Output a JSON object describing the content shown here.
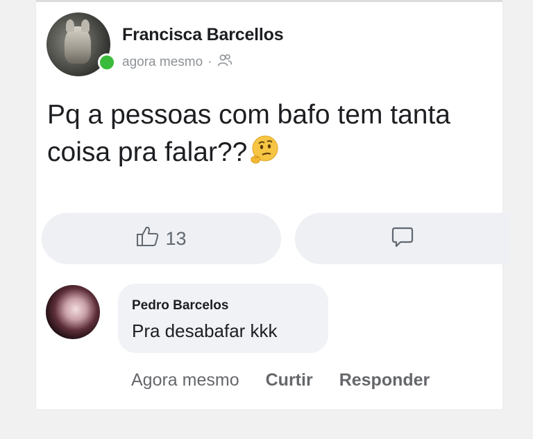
{
  "post": {
    "author": "Francisca Barcellos",
    "timestamp": "agora mesmo",
    "separator": "·",
    "audience_icon": "friends-icon",
    "text": "Pq a pessoas com bafo tem tanta coisa pra falar??",
    "emoji": "thinking-face-emoji",
    "like_count": "13",
    "like_icon": "thumbs-up-icon",
    "comment_icon": "comment-icon"
  },
  "comment": {
    "author": "Pedro Barcelos",
    "text": "Pra desabafar kkk",
    "time": "Agora mesmo",
    "like_action": "Curtir",
    "reply_action": "Responder"
  },
  "colors": {
    "online": "#3bbb3b",
    "button_bg": "#eef0f3",
    "bubble_bg": "#f0f2f5",
    "text": "#1c1e21",
    "muted": "#65676b"
  }
}
